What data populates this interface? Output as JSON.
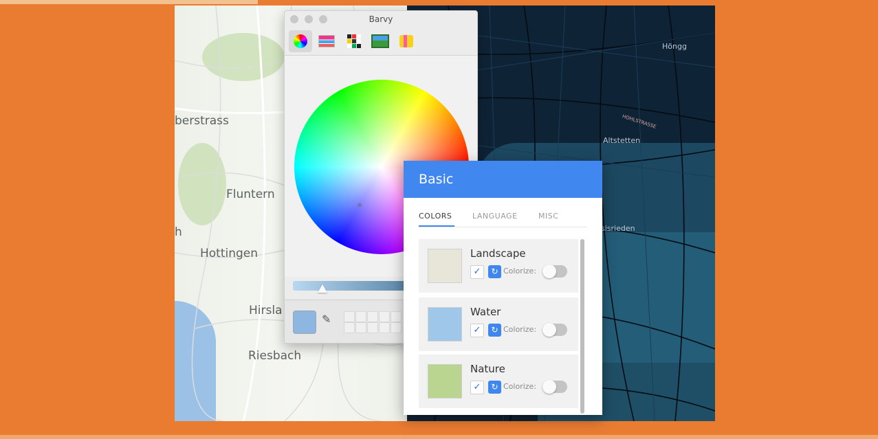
{
  "map": {
    "labels": [
      "berstrass",
      "Fluntern",
      "Hottingen",
      "Hirsla",
      "Riesbach",
      "h"
    ],
    "dark_labels": [
      "Höngg",
      "Altstetten",
      "sisrieden"
    ],
    "dark_roads": [
      "HOHLSTRASSE"
    ]
  },
  "barvy": {
    "title": "Barvy",
    "tools": [
      "color-wheel-icon",
      "color-sliders-icon",
      "color-palettes-icon",
      "image-palettes-icon",
      "crayons-icon"
    ],
    "current_color": "#8db7e0"
  },
  "basic": {
    "title": "Basic",
    "tabs": [
      {
        "label": "COLORS",
        "active": true
      },
      {
        "label": "LANGUAGE",
        "active": false
      },
      {
        "label": "MISC",
        "active": false
      }
    ],
    "items": [
      {
        "name": "Landscape",
        "color": "#e8e6d8",
        "checked": true,
        "colorize_label": "Colorize:",
        "colorize": false
      },
      {
        "name": "Water",
        "color": "#9fc7ea",
        "checked": true,
        "colorize_label": "Colorize:",
        "colorize": false
      },
      {
        "name": "Nature",
        "color": "#b9d58f",
        "checked": true,
        "colorize_label": "Colorize:",
        "colorize": false
      }
    ]
  }
}
